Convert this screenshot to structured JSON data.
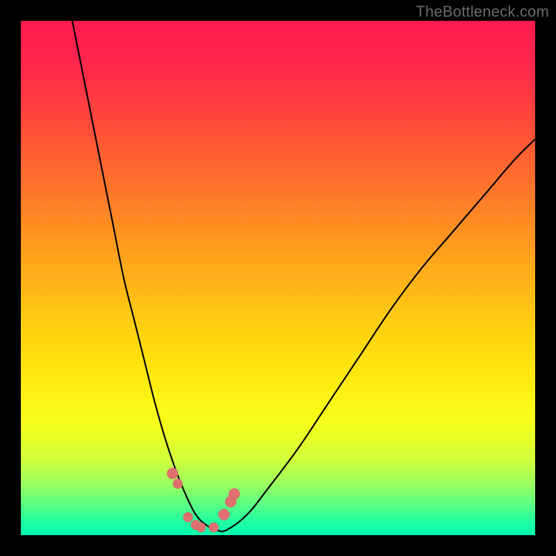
{
  "watermark": "TheBottleneck.com",
  "chart_data": {
    "type": "line",
    "title": "",
    "xlabel": "",
    "ylabel": "",
    "xlim": [
      0,
      100
    ],
    "ylim": [
      0,
      100
    ],
    "grid": false,
    "series": [
      {
        "name": "bottleneck-curve",
        "x": [
          10,
          12,
          14,
          16,
          18,
          20,
          22,
          24,
          26,
          28,
          30,
          32,
          34,
          36,
          38,
          40,
          44,
          48,
          54,
          60,
          66,
          72,
          78,
          84,
          90,
          96,
          100
        ],
        "values": [
          100,
          90,
          80,
          70,
          60,
          50,
          42,
          34,
          26,
          19,
          13,
          8,
          4,
          2,
          1,
          1,
          4,
          9,
          17,
          26,
          35,
          44,
          52,
          59,
          66,
          73,
          77
        ]
      }
    ],
    "markers": {
      "name": "highlight-points",
      "x": [
        29.5,
        30.5,
        32.5,
        34.0,
        35.0,
        37.5,
        39.5,
        40.8,
        41.5
      ],
      "values": [
        12.0,
        10.0,
        3.5,
        2.0,
        1.5,
        1.5,
        4.0,
        6.5,
        8.0
      ],
      "radius": [
        8,
        7,
        7,
        7,
        7,
        7,
        8,
        8,
        8
      ]
    },
    "gradient_colors": {
      "top": "#ff1a50",
      "mid": "#ffe60c",
      "bottom": "#00ffb0"
    }
  }
}
